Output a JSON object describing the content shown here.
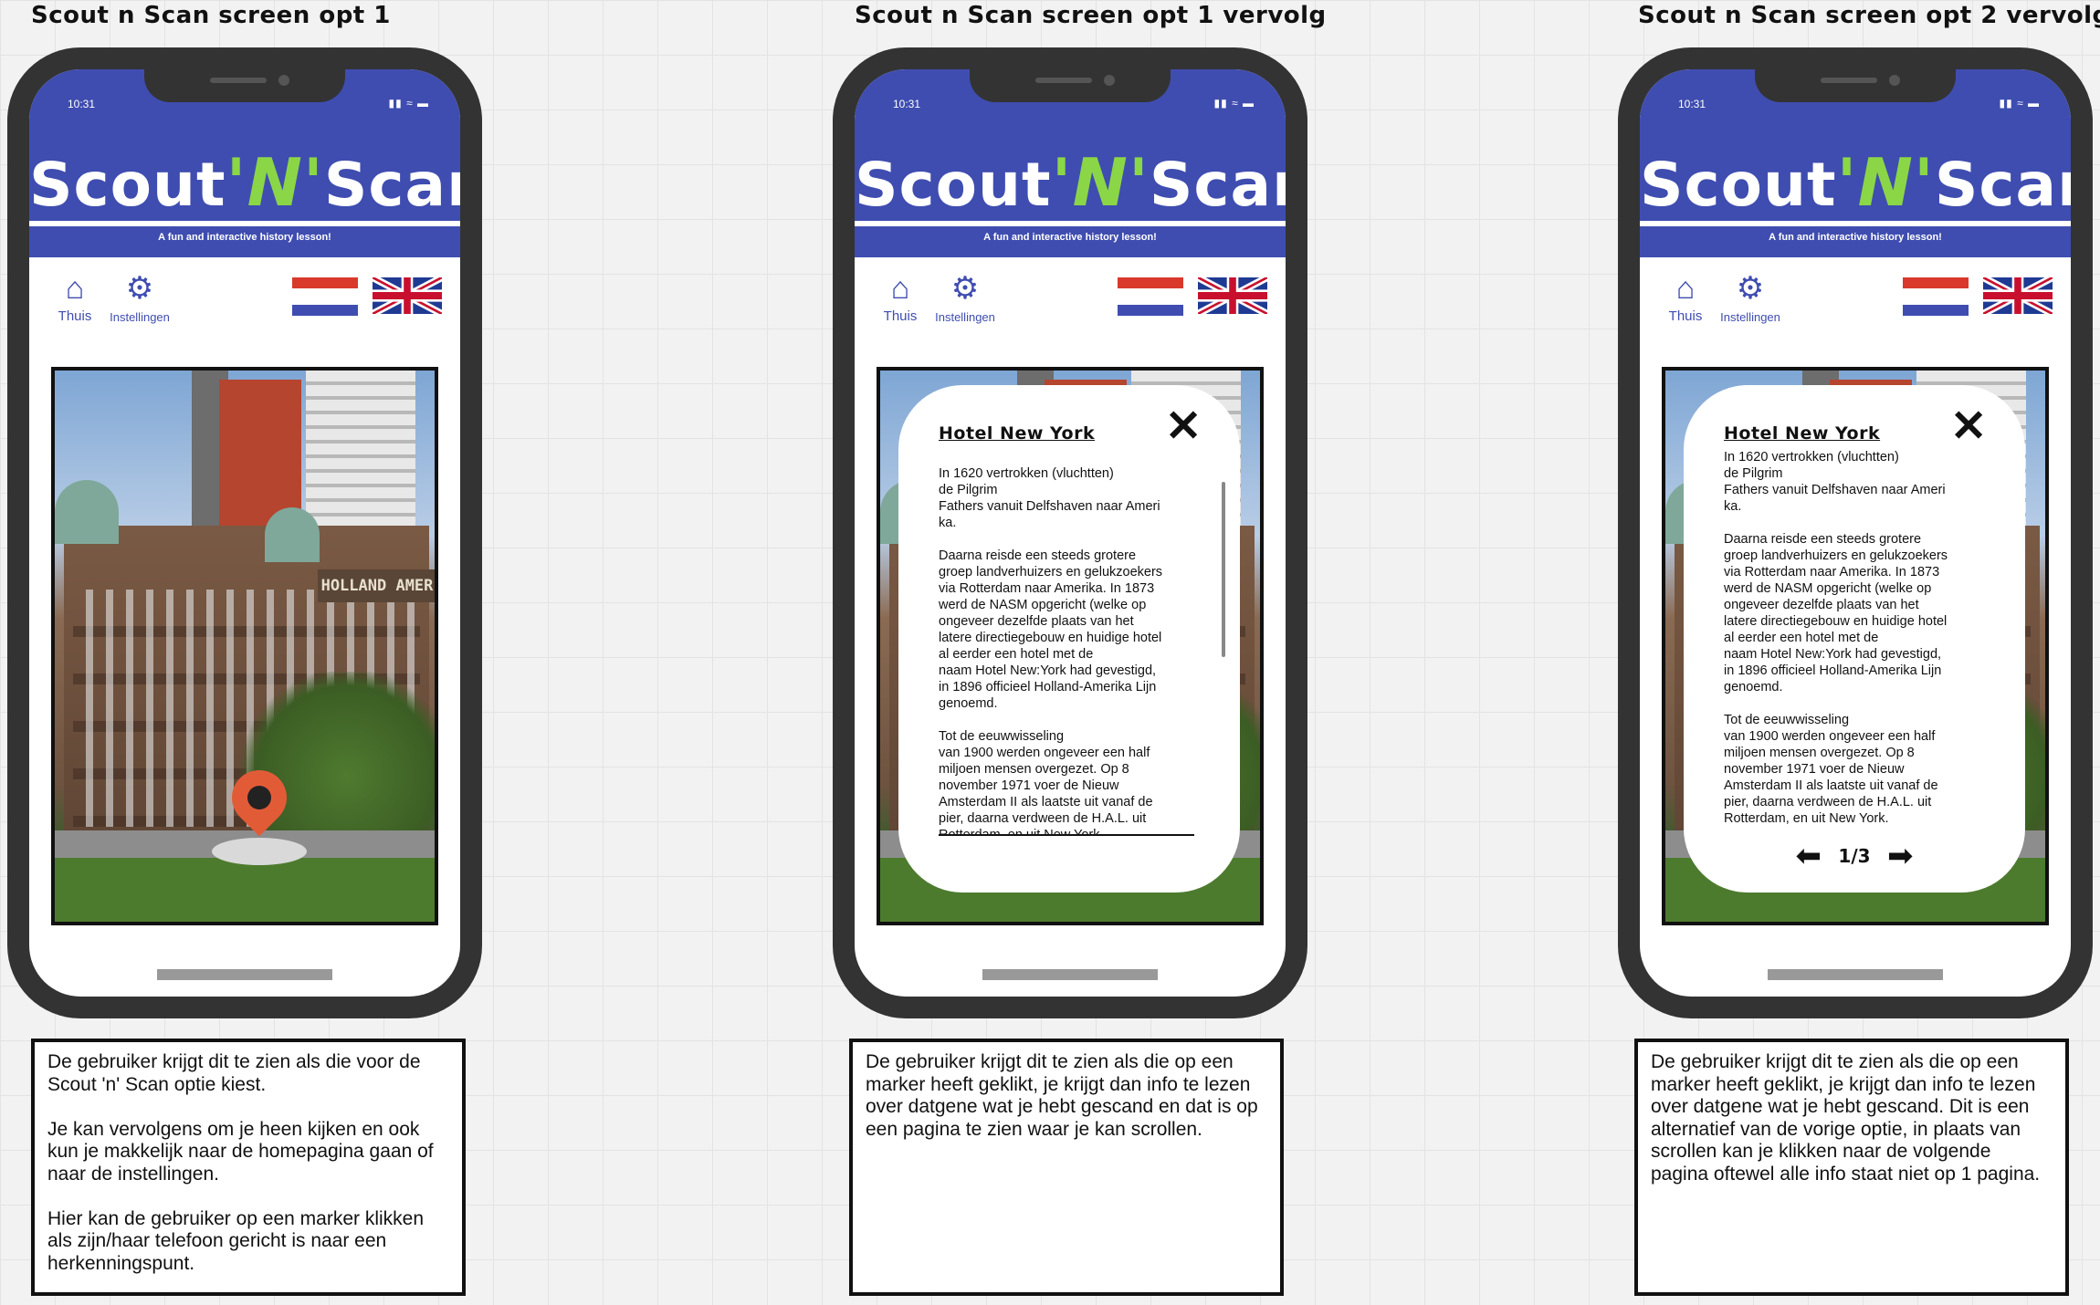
{
  "status_bar": {
    "time": "10:31",
    "icons": "▮▮ ≈ ▬"
  },
  "app_header": {
    "logo_part1": "Scout",
    "logo_part2": "'N'",
    "logo_part3": "Scan",
    "tagline": "A fun and interactive history lesson!"
  },
  "nav": {
    "home_label": "Thuis",
    "settings_label": "Instellingen"
  },
  "colors": {
    "brand_blue": "#3f4db0",
    "logo_green": "#8bd646",
    "marker_red": "#e25b37"
  },
  "icons": {
    "home": "home-icon",
    "settings": "gear-icon",
    "close": "close-icon",
    "marker": "map-marker-icon",
    "prev": "arrow-left-icon",
    "next": "arrow-right-icon"
  },
  "photo": {
    "sign_text": "HOLLAND AMER"
  },
  "screens": [
    {
      "title": "Scout n Scan screen opt 1",
      "description": "De gebruiker krijgt dit te zien als die voor de Scout 'n' Scan optie kiest.\n\nJe kan vervolgens om je heen kijken en ook kun je makkelijk naar de homepagina gaan of naar de instellingen.\n\nHier kan de gebruiker op een marker klikken als zijn/haar telefoon gericht is naar een herkenningspunt."
    },
    {
      "title": "Scout n Scan screen opt 1 vervolg",
      "info_title": "Hotel New York",
      "info_text": "In 1620 vertrokken (vluchtten)\nde Pilgrim\nFathers vanuit Delfshaven naar Ameri\nka.\n\nDaarna reisde een steeds grotere\ngroep landverhuizers en gelukzoekers\nvia Rotterdam naar Amerika. In 1873\nwerd de NASM opgericht (welke op\nongeveer dezelfde plaats van het\nlatere directiegebouw en huidige hotel\nal eerder een hotel met de\nnaam Hotel New:York had gevestigd,\nin 1896 officieel Holland-Amerika Lijn\ngenoemd.\n\nTot de eeuwwisseling\nvan 1900 werden ongeveer een half\nmiljoen mensen overgezet. Op 8\nnovember 1971 voer de Nieuw\nAmsterdam II als laatste uit vanaf de\npier, daarna verdween de H.A.L. uit\nRotterdam, en uit New York.",
      "description": "De gebruiker krijgt dit te zien als die op een marker heeft geklikt, je krijgt dan info te lezen over datgene wat je hebt gescand en dat is op een pagina te zien waar je kan scrollen."
    },
    {
      "title": "Scout n Scan screen opt 2 vervolg",
      "info_title": "Hotel New York",
      "info_text": "In 1620 vertrokken (vluchtten)\nde Pilgrim\nFathers vanuit Delfshaven naar Ameri\nka.\n\nDaarna reisde een steeds grotere\ngroep landverhuizers en gelukzoekers\nvia Rotterdam naar Amerika. In 1873\nwerd de NASM opgericht (welke op\nongeveer dezelfde plaats van het\nlatere directiegebouw en huidige hotel\nal eerder een hotel met de\nnaam Hotel New:York had gevestigd,\nin 1896 officieel Holland-Amerika Lijn\ngenoemd.\n\nTot de eeuwwisseling\nvan 1900 werden ongeveer een half\nmiljoen mensen overgezet. Op 8\nnovember 1971 voer de Nieuw\nAmsterdam II als laatste uit vanaf de\npier, daarna verdween de H.A.L. uit\nRotterdam, en uit New York.",
      "pager": "1/3",
      "description": "De gebruiker krijgt dit te zien als die op een marker heeft geklikt, je krijgt dan info te lezen over datgene wat je hebt gescand. Dit is een alternatief van de vorige optie, in plaats van scrollen kan je klikken naar de volgende pagina oftewel alle info staat niet op 1 pagina."
    }
  ]
}
